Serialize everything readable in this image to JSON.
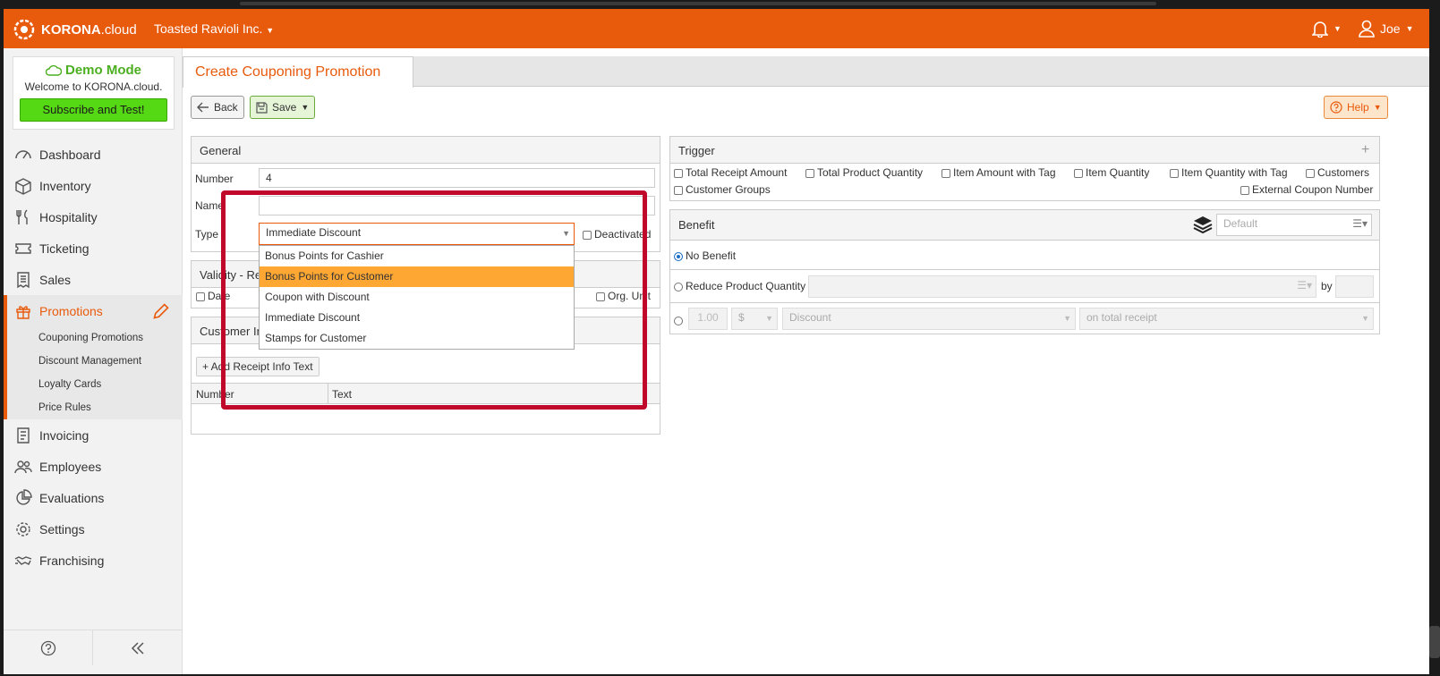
{
  "header": {
    "brand_bold": "KORONA",
    "brand_light": ".cloud",
    "company": "Toasted Ravioli Inc.",
    "user": "Joe"
  },
  "demo": {
    "title": "Demo Mode",
    "welcome": "Welcome to KORONA.cloud.",
    "subscribe": "Subscribe and Test!"
  },
  "nav": {
    "dashboard": "Dashboard",
    "inventory": "Inventory",
    "hospitality": "Hospitality",
    "ticketing": "Ticketing",
    "sales": "Sales",
    "promotions": "Promotions",
    "sub": {
      "couponing": "Couponing Promotions",
      "discount": "Discount Management",
      "loyalty": "Loyalty Cards",
      "price_rules": "Price Rules"
    },
    "invoicing": "Invoicing",
    "employees": "Employees",
    "evaluations": "Evaluations",
    "settings": "Settings",
    "franchising": "Franchising"
  },
  "tab": {
    "title": "Create Couponing Promotion"
  },
  "toolbar": {
    "back": "Back",
    "save": "Save",
    "help": "Help"
  },
  "general": {
    "title": "General",
    "number_label": "Number",
    "number_value": "4",
    "name_label": "Name",
    "type_label": "Type",
    "type_value": "Immediate Discount",
    "deactivated": "Deactivated"
  },
  "validity": {
    "title": "Validity - Re",
    "date": "Date",
    "org_unit": "Org. Unit"
  },
  "customer_info": {
    "title": "Customer In",
    "add_btn": "+ Add Receipt Info Text",
    "col_number": "Number",
    "col_text": "Text"
  },
  "type_options": [
    "Bonus Points for Cashier",
    "Bonus Points for Customer",
    "Coupon with Discount",
    "Immediate Discount",
    "Stamps for Customer"
  ],
  "trigger": {
    "title": "Trigger",
    "add": "+",
    "options": [
      "Total Receipt Amount",
      "Total Product Quantity",
      "Item Amount with Tag",
      "Item Quantity",
      "Item Quantity with Tag",
      "Customers",
      "Customer Groups",
      "External Coupon Number"
    ]
  },
  "benefit": {
    "title": "Benefit",
    "default_placeholder": "Default",
    "no_benefit": "No Benefit",
    "reduce_qty": "Reduce Product Quantity",
    "by": "by",
    "amount_placeholder": "1.00",
    "currency": "$",
    "discount_placeholder": "Discount",
    "scope_placeholder": "on total receipt"
  }
}
